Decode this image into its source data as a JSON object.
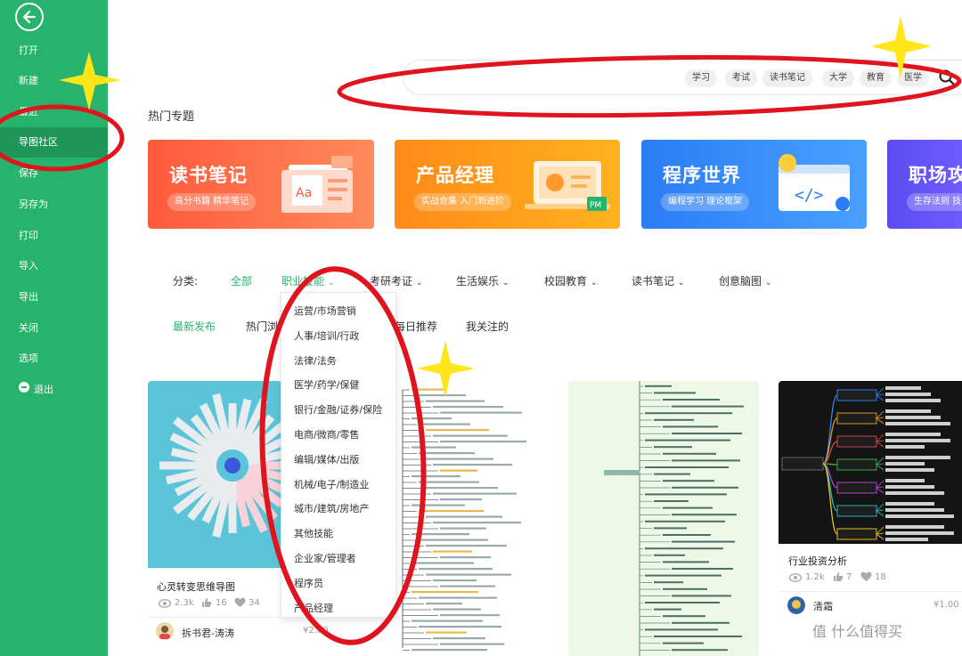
{
  "window": {
    "title": ""
  },
  "sidebar": {
    "items": [
      {
        "label": "打开"
      },
      {
        "label": "新建"
      },
      {
        "label": "最近"
      },
      {
        "label": "导图社区"
      },
      {
        "label": "保存"
      },
      {
        "label": "另存为"
      },
      {
        "label": "打印"
      },
      {
        "label": "导入"
      },
      {
        "label": "导出"
      },
      {
        "label": "关闭"
      },
      {
        "label": "选项"
      },
      {
        "label": "退出"
      }
    ],
    "active_index": 3
  },
  "search": {
    "placeholder": "",
    "tags": [
      "学习",
      "考试",
      "读书笔记",
      "大学",
      "教育",
      "医学"
    ]
  },
  "hot": {
    "title": "热门专题",
    "banners": [
      {
        "title": "读书笔记",
        "subtitle": "高分书籍 精华笔记",
        "art_text": "Aa"
      },
      {
        "title": "产品经理",
        "subtitle": "实战合集 入门到进阶",
        "art_text": "PM"
      },
      {
        "title": "程序世界",
        "subtitle": "编程学习 理论框架",
        "art_text": "</>"
      },
      {
        "title": "职场攻",
        "subtitle": "生存法则 技"
      }
    ]
  },
  "filter": {
    "label": "分类:",
    "categories": [
      {
        "label": "全部",
        "has_menu": false
      },
      {
        "label": "职业技能",
        "has_menu": true
      },
      {
        "label": "考研考证",
        "has_menu": true
      },
      {
        "label": "生活娱乐",
        "has_menu": true
      },
      {
        "label": "校园教育",
        "has_menu": true
      },
      {
        "label": "读书笔记",
        "has_menu": true
      },
      {
        "label": "创意脑图",
        "has_menu": true
      }
    ],
    "selected": "全部"
  },
  "sort_tabs": [
    "最新发布",
    "热门浏览",
    "每日推荐",
    "我关注的"
  ],
  "dropdown": {
    "items": [
      "运营/市场营销",
      "人事/培训/行政",
      "法律/法务",
      "医学/药学/保健",
      "银行/金融/证券/保险",
      "电商/微商/零售",
      "编辑/媒体/出版",
      "机械/电子/制造业",
      "城市/建筑/房地产",
      "其他技能",
      "企业家/管理者",
      "程序员",
      "产品经理"
    ]
  },
  "cards": [
    {
      "title": "心灵转变思维导图",
      "views": "2.3k",
      "likes": "16",
      "favs": "34",
      "author": "拆书君-涛涛",
      "price": "¥2.00"
    },
    {
      "title": "",
      "views": "",
      "likes": "",
      "favs": "",
      "author": "",
      "price": ""
    },
    {
      "title": "",
      "views": "",
      "likes": "",
      "favs": "",
      "author": "",
      "price": ""
    },
    {
      "title": "行业投资分析",
      "views": "1.2k",
      "likes": "7",
      "favs": "18",
      "author": "清霜",
      "price": "¥1.00"
    }
  ],
  "watermark": "值 什么值得买",
  "colors": {
    "sidebar": "#27b36b",
    "accent": "#27b36b",
    "annotation_red": "#e0141e",
    "annotation_star": "#ffe61a"
  },
  "icons": {
    "back": "back-arrow-icon",
    "search": "search-icon",
    "exit": "exit-icon",
    "views": "eye-icon",
    "likes": "thumbs-up-icon",
    "favs": "heart-icon"
  }
}
